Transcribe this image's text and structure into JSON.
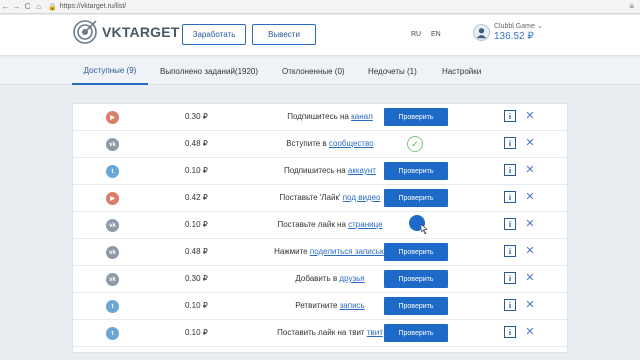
{
  "browser": {
    "url": "https://vktarget.ru/list/",
    "back_icon": "←",
    "forward_icon": "→",
    "reload_icon": "C",
    "home_icon": "⌂",
    "lock_icon": "🔒",
    "menu_icon": "≡"
  },
  "header": {
    "logo_text": "VKTARGET",
    "earn_label": "Заработать",
    "withdraw_label": "Вывести",
    "lang_ru": "RU",
    "lang_en": "EN",
    "user_name": "Clubbl Game",
    "user_name_chevron": "⌄",
    "balance": "136.52 ₽"
  },
  "tabs": [
    {
      "label": "Доступные (9)",
      "active": true
    },
    {
      "label": "Выполнено заданий(1920)",
      "active": false
    },
    {
      "label": "Отклоненные (0)",
      "active": false
    },
    {
      "label": "Недочеты (1)",
      "active": false
    },
    {
      "label": "Настройки",
      "active": false
    }
  ],
  "tasks": [
    {
      "network": "yt",
      "network_icon": "▶",
      "price": "0.30 ₽",
      "text": "Подпишитесь на ",
      "link": "канал",
      "state": "button",
      "button_label": "Проверить"
    },
    {
      "network": "vk",
      "network_icon": "vk",
      "price": "0.48 ₽",
      "text": "Вступите в ",
      "link": "сообщество",
      "state": "done",
      "button_label": ""
    },
    {
      "network": "tw",
      "network_icon": "t",
      "price": "0.10 ₽",
      "text": "Подпишитесь на ",
      "link": "аккаунт",
      "state": "button",
      "button_label": "Проверить"
    },
    {
      "network": "yt",
      "network_icon": "▶",
      "price": "0.42 ₽",
      "text": "Поставьте 'Лайк' ",
      "link": "под видео",
      "state": "button",
      "button_label": "Проверить"
    },
    {
      "network": "vk",
      "network_icon": "vk",
      "price": "0.10 ₽",
      "text": "Поставьте лайк на ",
      "link": "странице",
      "state": "loading",
      "button_label": ""
    },
    {
      "network": "vk",
      "network_icon": "vk",
      "price": "0.48 ₽",
      "text": "Нажмите ",
      "link": "поделиться записью",
      "state": "button",
      "button_label": "Проверить"
    },
    {
      "network": "vk",
      "network_icon": "vk",
      "price": "0.30 ₽",
      "text": "Добавить в ",
      "link": "друзья",
      "state": "button",
      "button_label": "Проверить"
    },
    {
      "network": "tw",
      "network_icon": "t",
      "price": "0.10 ₽",
      "text": "Ретвитните ",
      "link": "запись",
      "state": "button",
      "button_label": "Проверить"
    },
    {
      "network": "tw",
      "network_icon": "t",
      "price": "0.10 ₽",
      "text": "Поставить лайк на твит ",
      "link": "твит",
      "state": "button",
      "button_label": "Проверить"
    }
  ],
  "icons": {
    "check": "✓",
    "info": "i",
    "close": "✕"
  },
  "colors": {
    "accent": "#1e6ac8",
    "balance": "#3a76c2",
    "youtube": "#d87e6a",
    "vk": "#8e9aaa",
    "twitter": "#6ba7d6"
  }
}
